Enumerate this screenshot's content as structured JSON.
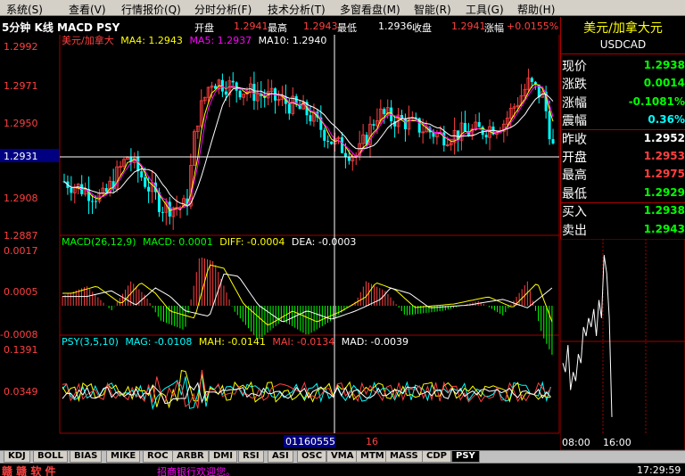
{
  "menu": [
    "系统(S)",
    "查看(V)",
    "行情报价(Q)",
    "分时分析(F)",
    "技术分析(T)",
    "多窗看盘(M)",
    "智能(R)",
    "工具(G)",
    "帮助(H)"
  ],
  "period_title": "5分钟 K线 MACD PSY",
  "info": {
    "open_label": "开盘",
    "open_value": "1.2941",
    "high_label": "最高",
    "high_value": "1.2943",
    "low_label": "最低",
    "low_value": "1.2936",
    "close_label": "收盘",
    "close_value": "1.2941",
    "change_label": "涨幅",
    "change_value": "+0.0155%"
  },
  "price_header": {
    "name": "美元/加拿大",
    "ma4": "MA4: 1.2943",
    "ma5": "MA5: 1.2937",
    "ma10": "MA10: 1.2940"
  },
  "price_axis": [
    "1.2992",
    "1.2971",
    "1.2950",
    "1.2931",
    "1.2908",
    "1.2887"
  ],
  "macd_header": {
    "name": "MACD(26,12,9)",
    "macd": "MACD: 0.0001",
    "diff": "DIFF: -0.0004",
    "dea": "DEA: -0.0003"
  },
  "macd_axis": [
    "0.0017",
    "0.0005",
    "-0.0008"
  ],
  "psy_header": {
    "name": "PSY(3,5,10)",
    "mag": "MAG: -0.0108",
    "mah": "MAH: -0.0141",
    "mai": "MAI: -0.0134",
    "mad": "MAD: -0.0039"
  },
  "psy_axis": [
    "0.1391",
    "0.0349"
  ],
  "cursor": {
    "date": "01160555",
    "minute": "16"
  },
  "panel": {
    "title": "美元/加拿大元",
    "code": "USDCAD",
    "rows": [
      {
        "label": "现价",
        "value": "1.2938",
        "color": "#00ff00"
      },
      {
        "label": "涨跌",
        "value": "0.0014",
        "color": "#00ff00"
      },
      {
        "label": "涨幅",
        "value": "-0.1081%",
        "color": "#00ff00"
      },
      {
        "label": "震幅",
        "value": "0.36%",
        "color": "#00ffff"
      },
      {
        "label": "昨收",
        "value": "1.2952",
        "color": "#ffffff"
      },
      {
        "label": "开盘",
        "value": "1.2953",
        "color": "#ff4040"
      },
      {
        "label": "最高",
        "value": "1.2975",
        "color": "#ff4040"
      },
      {
        "label": "最低",
        "value": "1.2929",
        "color": "#00ff00"
      },
      {
        "label": "买入",
        "value": "1.2938",
        "color": "#00ff00"
      },
      {
        "label": "卖出",
        "value": "1.2943",
        "color": "#00ff00"
      }
    ]
  },
  "mini_chart": {
    "times": [
      "08:00",
      "16:00"
    ],
    "values": [
      0.35,
      0.3,
      0.45,
      0.2,
      0.3,
      0.25,
      0.4,
      0.35,
      0.55,
      0.5,
      0.6,
      0.55,
      0.65,
      0.5,
      0.7,
      0.6,
      0.95,
      0.85,
      0.6,
      0.05
    ]
  },
  "tabs": [
    "KDJ",
    "BOLL",
    "BIAS",
    "MIKE",
    "ROC",
    "ARBR",
    "DMI",
    "RSI",
    "ASI",
    "OSC",
    "VMA",
    "MTM",
    "MASS",
    "CDP",
    "PSY"
  ],
  "active_tab": "PSY",
  "status": {
    "brand": "赣 赣 软 件",
    "marquee": "招商银行欢迎您。",
    "time": "17:29:59"
  },
  "colors": {
    "up": "#ff4040",
    "down": "#00ffff",
    "ma4": "#ffff00",
    "ma5": "#ff00ff",
    "ma10": "#ffffff",
    "axis": "#a00000",
    "green": "#00ff00"
  }
}
